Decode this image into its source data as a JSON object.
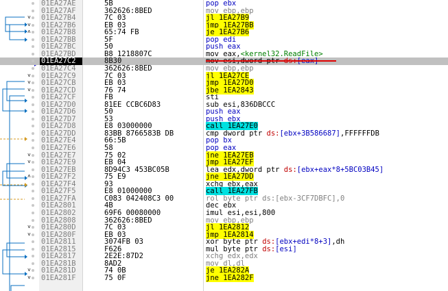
{
  "selected_index": 9,
  "rows": [
    {
      "addr": "01EA27AE",
      "arrow": "",
      "bytes": "5B",
      "parts": [
        [
          "pop ebx",
          "m-blue"
        ]
      ]
    },
    {
      "addr": "01EA27AF",
      "arrow": "",
      "bytes": "362626:8BED",
      "parts": [
        [
          "mov ebp,ebp",
          "m-gray"
        ]
      ]
    },
    {
      "addr": "01EA27B4",
      "arrow": "v",
      "bytes": "7C 03",
      "parts": [
        [
          "jl 1EA27B9",
          "hl-yellow"
        ]
      ]
    },
    {
      "addr": "01EA27B6",
      "arrow": "v",
      "bytes": "EB 03",
      "parts": [
        [
          "jmp 1EA27BB",
          "hl-yellow"
        ]
      ]
    },
    {
      "addr": "01EA27B8",
      "arrow": "^",
      "bytes": "65:74 FB",
      "parts": [
        [
          "je 1EA27B6",
          "hl-yellow"
        ]
      ]
    },
    {
      "addr": "01EA27BB",
      "arrow": "",
      "bytes": "5F",
      "parts": [
        [
          "pop edi",
          "m-blue"
        ]
      ]
    },
    {
      "addr": "01EA27BC",
      "arrow": "",
      "bytes": "50",
      "parts": [
        [
          "push eax",
          "m-blue"
        ]
      ]
    },
    {
      "addr": "01EA27BD",
      "arrow": "",
      "bytes": "B8 1218807C",
      "parts": [
        [
          "mov eax,",
          "m-black"
        ],
        [
          "<kernel32.ReadFile>",
          "green"
        ]
      ]
    },
    {
      "addr": "01EA27C2",
      "arrow": "",
      "bytes": "8B30",
      "parts": [
        [
          "mov esi,dword ptr ",
          "m-black"
        ],
        [
          "ds:",
          "red"
        ],
        [
          "[eax]",
          "blue"
        ]
      ],
      "strike": true
    },
    {
      "addr": "01EA27C2",
      "arrow": "",
      "bytes": "8B30",
      "parts": [
        [
          "mov esi,dword ptr ",
          "m-black"
        ],
        [
          "ds:",
          "red"
        ],
        [
          "[eax]",
          "blue"
        ]
      ],
      "strike": true
    },
    {
      "addr": "01EA27C4",
      "arrow": "",
      "bytes": "362626:8BED",
      "parts": [
        [
          "mov ebp,ebp",
          "m-gray"
        ]
      ]
    },
    {
      "addr": "01EA27C9",
      "arrow": "v",
      "bytes": "7C 03",
      "parts": [
        [
          "jl 1EA27CE",
          "hl-yellow"
        ]
      ]
    },
    {
      "addr": "01EA27CB",
      "arrow": "v",
      "bytes": "EB 03",
      "parts": [
        [
          "jmp 1EA27D0",
          "hl-yellow"
        ]
      ]
    },
    {
      "addr": "01EA27CD",
      "arrow": "v",
      "bytes": "76 74",
      "parts": [
        [
          "jbe 1EA2843",
          "hl-yellow"
        ]
      ]
    },
    {
      "addr": "01EA27CF",
      "arrow": "",
      "bytes": "FB",
      "parts": [
        [
          "sti",
          "m-black"
        ]
      ]
    },
    {
      "addr": "01EA27D0",
      "arrow": "",
      "bytes": "81EE CCBC6D83",
      "parts": [
        [
          "sub esi,836DBCCC",
          "m-black"
        ]
      ]
    },
    {
      "addr": "01EA27D6",
      "arrow": "",
      "bytes": "50",
      "parts": [
        [
          "push eax",
          "m-blue"
        ]
      ]
    },
    {
      "addr": "01EA27D7",
      "arrow": "",
      "bytes": "53",
      "parts": [
        [
          "push ebx",
          "m-blue"
        ]
      ]
    },
    {
      "addr": "01EA27D8",
      "arrow": "",
      "bytes": "E8 03000000",
      "parts": [
        [
          "call 1EA27E0",
          "hl-cyan"
        ]
      ]
    },
    {
      "addr": "01EA27DD",
      "arrow": "",
      "bytes": "83BB 8766583B DB",
      "parts": [
        [
          "cmp dword ptr ",
          "m-black"
        ],
        [
          "ds:",
          "red"
        ],
        [
          "[ebx+3B586687]",
          "blue"
        ],
        [
          ",FFFFFFDB",
          "m-black"
        ]
      ]
    },
    {
      "addr": "01EA27E4",
      "arrow": "",
      "bytes": "66:5B",
      "parts": [
        [
          "pop bx",
          "m-blue"
        ]
      ]
    },
    {
      "addr": "01EA27E6",
      "arrow": "",
      "bytes": "58",
      "parts": [
        [
          "pop eax",
          "m-blue"
        ]
      ]
    },
    {
      "addr": "01EA27E7",
      "arrow": "v",
      "bytes": "75 02",
      "parts": [
        [
          "jne 1EA27EB",
          "hl-yellow"
        ]
      ]
    },
    {
      "addr": "01EA27E9",
      "arrow": "v",
      "bytes": "EB 04",
      "parts": [
        [
          "jmp 1EA27EF",
          "hl-yellow"
        ]
      ]
    },
    {
      "addr": "01EA27EB",
      "arrow": "",
      "bytes": "8D94C3 453BC05B",
      "parts": [
        [
          "lea edx,dword ptr ",
          "m-black"
        ],
        [
          "ds:",
          "red"
        ],
        [
          "[ebx+eax*8+5BC03B45]",
          "blue"
        ]
      ]
    },
    {
      "addr": "01EA27F2",
      "arrow": "^",
      "bytes": "75 E9",
      "parts": [
        [
          "jne 1EA27DD",
          "hl-yellow"
        ]
      ]
    },
    {
      "addr": "01EA27F4",
      "arrow": "",
      "bytes": "93",
      "parts": [
        [
          "xchg ebx,eax",
          "m-black"
        ]
      ]
    },
    {
      "addr": "01EA27F5",
      "arrow": "",
      "bytes": "E8 01000000",
      "parts": [
        [
          "call 1EA27FB",
          "hl-cyan"
        ]
      ]
    },
    {
      "addr": "01EA27FA",
      "arrow": "",
      "bytes": "C083 042408C3 00",
      "parts": [
        [
          "rol byte ptr ds:[ebx-3CF7DBFC],0",
          "m-gray"
        ]
      ]
    },
    {
      "addr": "01EA2801",
      "arrow": "",
      "bytes": "4B",
      "parts": [
        [
          "dec ebx",
          "m-black"
        ]
      ]
    },
    {
      "addr": "01EA2802",
      "arrow": "",
      "bytes": "69F6 00080000",
      "parts": [
        [
          "imul esi,esi,800",
          "m-black"
        ]
      ]
    },
    {
      "addr": "01EA2808",
      "arrow": "",
      "bytes": "362626:8BED",
      "parts": [
        [
          "mov ebp,ebp",
          "m-gray"
        ]
      ]
    },
    {
      "addr": "01EA280D",
      "arrow": "v",
      "bytes": "7C 03",
      "parts": [
        [
          "jl 1EA2812",
          "hl-yellow"
        ]
      ]
    },
    {
      "addr": "01EA280F",
      "arrow": "v",
      "bytes": "EB 03",
      "parts": [
        [
          "jmp 1EA2814",
          "hl-yellow"
        ]
      ]
    },
    {
      "addr": "01EA2811",
      "arrow": "",
      "bytes": "3074FB 03",
      "parts": [
        [
          "xor byte ptr ",
          "m-black"
        ],
        [
          "ds:",
          "red"
        ],
        [
          "[ebx+edi*8+3]",
          "blue"
        ],
        [
          ",dh",
          "m-black"
        ]
      ]
    },
    {
      "addr": "01EA2815",
      "arrow": "",
      "bytes": "F626",
      "parts": [
        [
          "mul byte ptr ",
          "m-black"
        ],
        [
          "ds:",
          "red"
        ],
        [
          "[esi]",
          "blue"
        ]
      ]
    },
    {
      "addr": "01EA2817",
      "arrow": "",
      "bytes": "2E2E:87D2",
      "parts": [
        [
          "xchg edx,edx",
          "m-gray"
        ]
      ]
    },
    {
      "addr": "01EA281B",
      "arrow": "",
      "bytes": "8AD2",
      "parts": [
        [
          "mov dl,dl",
          "m-gray"
        ]
      ]
    },
    {
      "addr": "01EA281D",
      "arrow": "v",
      "bytes": "74 0B",
      "parts": [
        [
          "je 1EA282A",
          "hl-yellow"
        ]
      ]
    },
    {
      "addr": "01EA281F",
      "arrow": "v",
      "bytes": "75 0F",
      "parts": [
        [
          "jne 1EA282F",
          "hl-yellow"
        ]
      ]
    }
  ]
}
